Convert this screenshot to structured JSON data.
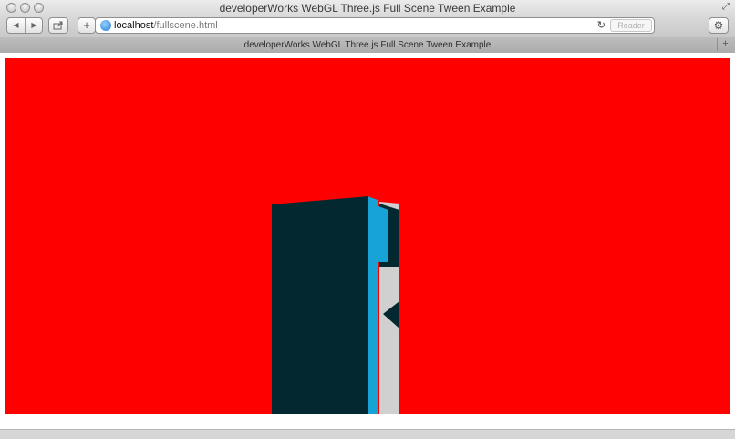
{
  "window": {
    "title": "developerWorks WebGL Three.js Full Scene Tween Example"
  },
  "toolbar": {
    "back_icon": "◀",
    "forward_icon": "▶",
    "share_icon": "share-icon",
    "add_icon": "+",
    "url_host": "localhost",
    "url_path": "/fullscene.html",
    "reload_icon": "↻",
    "reader_label": "Reader",
    "settings_icon": "⚙"
  },
  "tab": {
    "label": "developerWorks WebGL Three.js Full Scene Tween Example",
    "new_tab_icon": "+"
  },
  "scene": {
    "background_color": "#ff0000",
    "panel_dark_color": "#042830",
    "accent_cyan_color": "#17a3d6",
    "panel_light_color": "#d0d0d0"
  }
}
